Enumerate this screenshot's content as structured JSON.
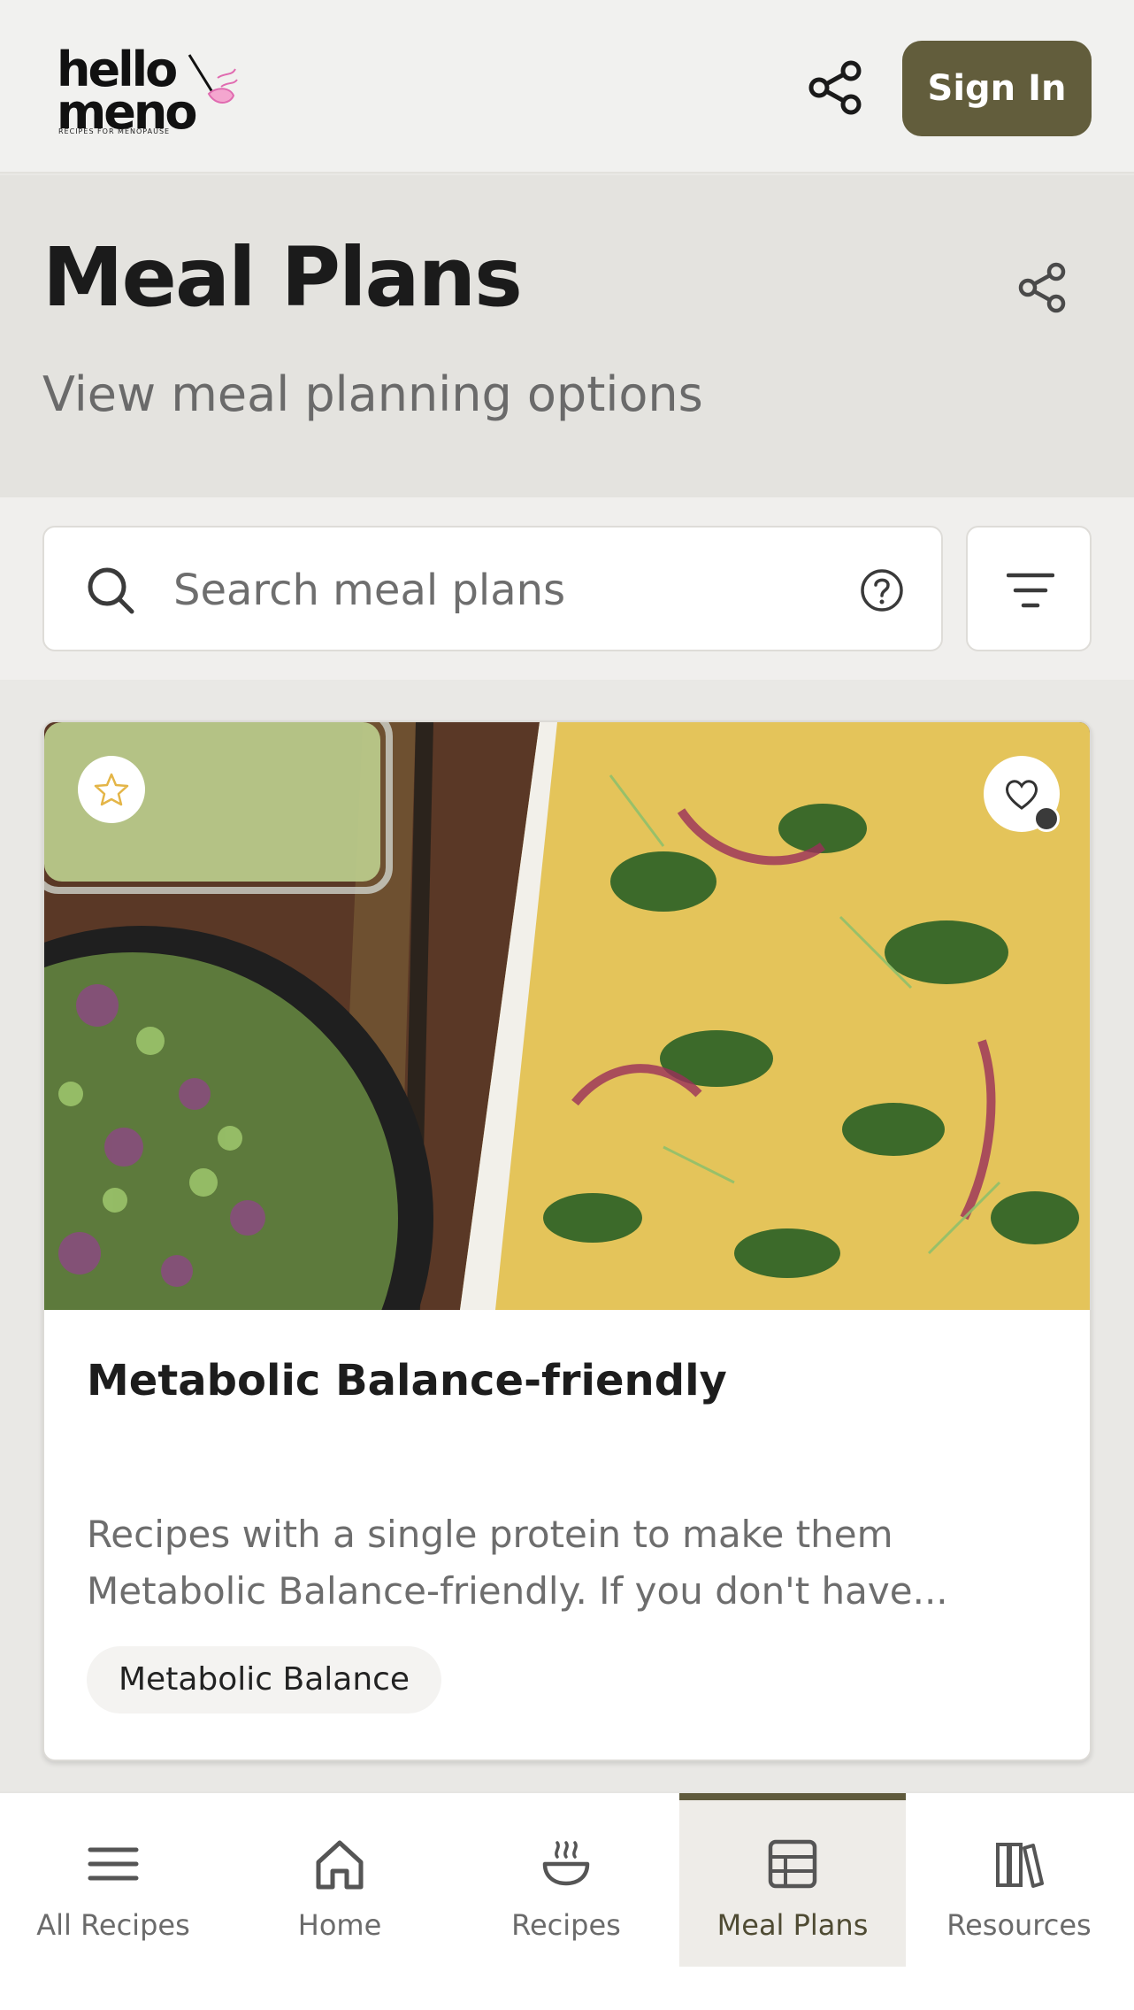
{
  "brand": {
    "logo_line1": "hello",
    "logo_line2": "meno",
    "logo_tagline": "RECIPES FOR MENOPAUSE"
  },
  "header": {
    "sign_in_label": "Sign In",
    "share_icon": "share-icon"
  },
  "page": {
    "title": "Meal Plans",
    "subtitle": "View meal planning options"
  },
  "search": {
    "placeholder": "Search meal plans",
    "value": "",
    "help_icon": "help-icon",
    "filter_icon": "filter-icon"
  },
  "cards": [
    {
      "title": "Metabolic Balance-friendly",
      "description_line1": "Recipes with a single protein to make them",
      "description_line2": "Metabolic Balance-friendly. If you don't have...",
      "tag": "Metabolic Balance",
      "favorite_icon": "star-icon",
      "add_favorite_icon": "heart-plus-icon"
    }
  ],
  "nav": {
    "items": [
      {
        "label": "All Recipes",
        "icon": "menu-icon"
      },
      {
        "label": "Home",
        "icon": "home-icon"
      },
      {
        "label": "Recipes",
        "icon": "bowl-icon"
      },
      {
        "label": "Meal Plans",
        "icon": "grid-icon",
        "active": true
      },
      {
        "label": "Resources",
        "icon": "books-icon"
      }
    ]
  },
  "colors": {
    "brand_olive": "#625d3c",
    "background": "#e9e8e5",
    "text": "#1f1f1f",
    "muted": "#6d6d6d"
  }
}
